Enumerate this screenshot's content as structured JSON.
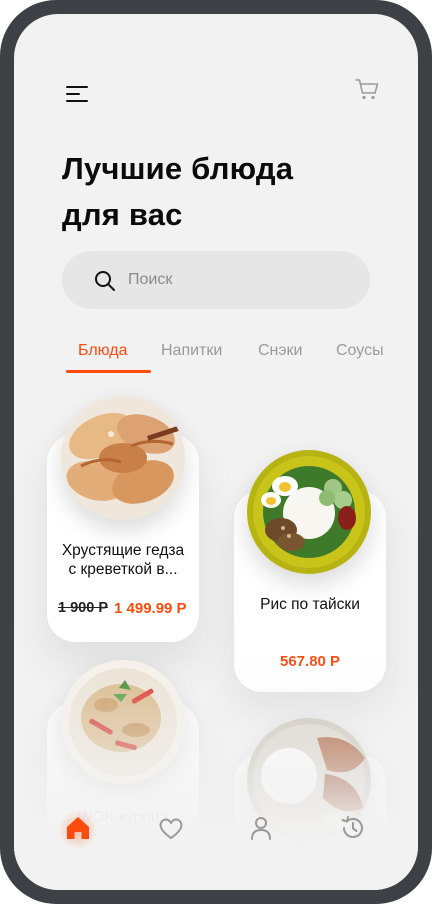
{
  "header": {
    "title_line1": "Лучшие блюда",
    "title_line2": "для вас"
  },
  "search": {
    "placeholder": "Поиск"
  },
  "tabs": [
    {
      "label": "Блюда",
      "active": true
    },
    {
      "label": "Напитки",
      "active": false
    },
    {
      "label": "Снэки",
      "active": false
    },
    {
      "label": "Соусы",
      "active": false
    }
  ],
  "products": [
    {
      "name_line1": "Хрустящие гедза",
      "name_line2": "с креветкой в...",
      "old_price": "1 900 Р",
      "price": "1 499.99 Р"
    },
    {
      "name_line1": "Рис по тайски",
      "price": "567.80 Р"
    },
    {
      "name_line1": "WOK курица"
    },
    {
      "name_line1": ""
    }
  ],
  "bottom_nav": [
    {
      "icon": "home-icon",
      "active": true
    },
    {
      "icon": "heart-icon",
      "active": false
    },
    {
      "icon": "user-icon",
      "active": false
    },
    {
      "icon": "history-icon",
      "active": false
    }
  ],
  "colors": {
    "accent": "#fa4a0c",
    "background": "#f2f2f2",
    "frame": "#3d4044"
  }
}
